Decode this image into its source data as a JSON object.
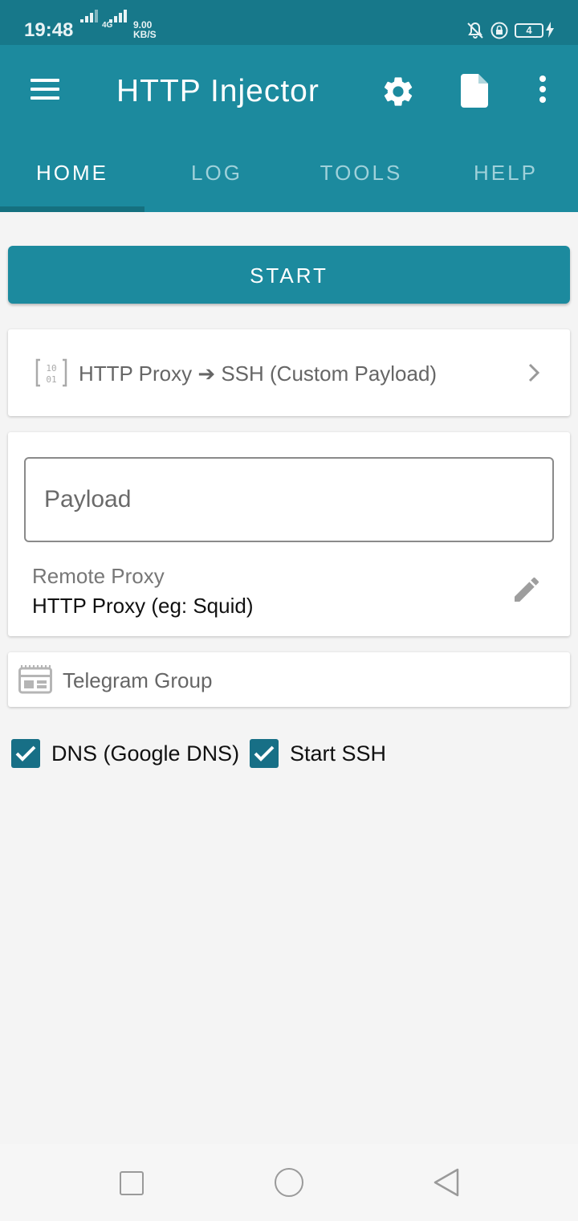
{
  "status_bar": {
    "time": "19:48",
    "network_type": "4G",
    "speed_value": "9.00",
    "speed_unit": "KB/S",
    "battery_level": "4"
  },
  "app_bar": {
    "title": "HTTP Injector"
  },
  "tabs": [
    {
      "label": "HOME",
      "active": true
    },
    {
      "label": "LOG",
      "active": false
    },
    {
      "label": "TOOLS",
      "active": false
    },
    {
      "label": "HELP",
      "active": false
    }
  ],
  "start_button": {
    "label": "START"
  },
  "mode": {
    "label": "HTTP Proxy ➔ SSH (Custom Payload)",
    "icon": "binary-icon"
  },
  "payload": {
    "placeholder": "Payload"
  },
  "remote_proxy": {
    "label": "Remote Proxy",
    "value": "HTTP Proxy (eg: Squid)"
  },
  "telegram": {
    "label": "Telegram Group"
  },
  "checkboxes": [
    {
      "label": "DNS (Google DNS)",
      "checked": true
    },
    {
      "label": "Start SSH",
      "checked": true
    }
  ],
  "colors": {
    "primary": "#1c8a9e",
    "status_bar": "#17788a",
    "checkbox": "#176f86",
    "background": "#f4f4f4"
  }
}
